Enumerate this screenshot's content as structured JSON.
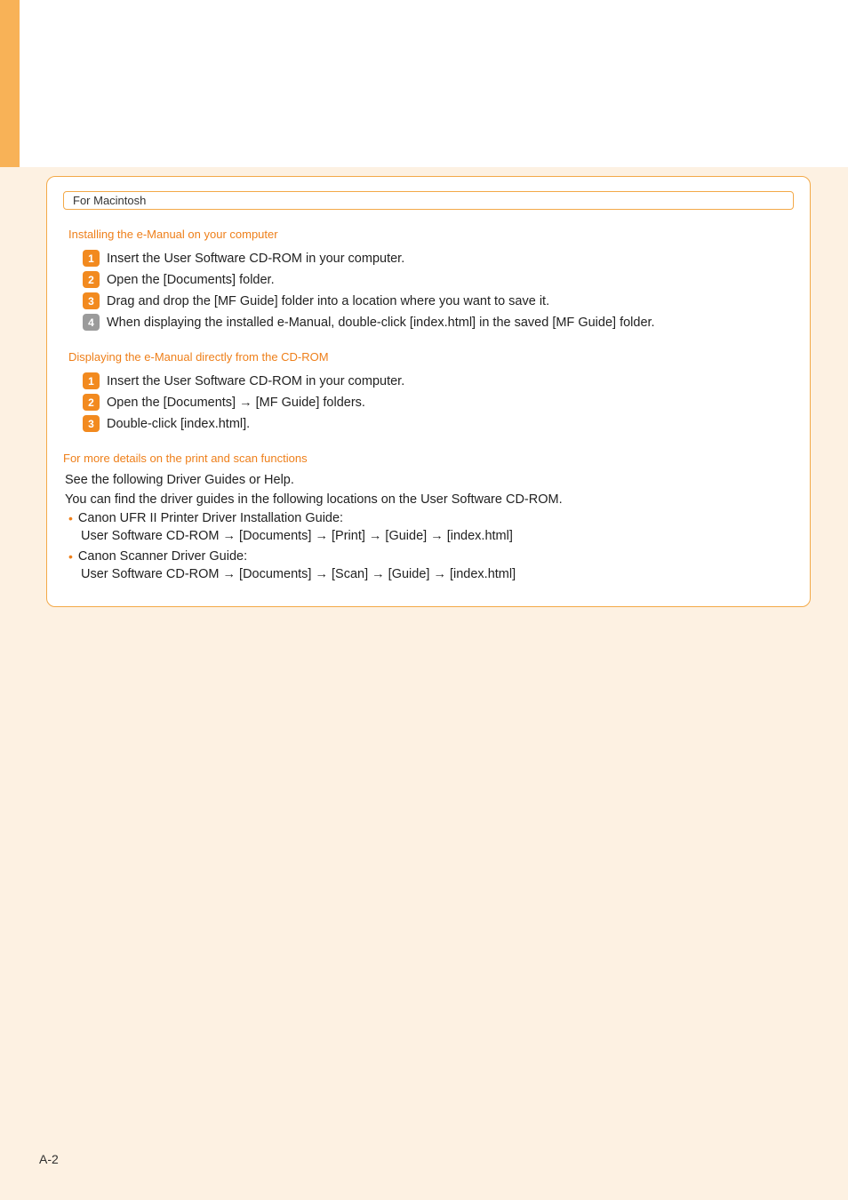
{
  "tag": "For Macintosh",
  "sectionInstall": {
    "title": "Installing the e-Manual on your computer",
    "steps": [
      "Insert the User Software CD-ROM in your computer.",
      "Open the [Documents] folder.",
      "Drag and drop the [MF Guide] folder into a location where you want to save it.",
      "When displaying the installed e-Manual, double-click [index.html] in the saved [MF Guide] folder."
    ]
  },
  "sectionDisplay": {
    "title": "Displaying the e-Manual directly from the CD-ROM",
    "steps": [
      "Insert the User Software CD-ROM in your computer.",
      "Open the [Documents] → [MF Guide] folders.",
      "Double-click [index.html]."
    ]
  },
  "sectionDetails": {
    "title": "For more details on the print and scan functions",
    "intro1": "See the following Driver Guides or Help.",
    "intro2": "You can find the driver guides in the following locations on the User Software CD-ROM.",
    "bullets": [
      {
        "head": "Canon UFR II Printer Driver Installation Guide:",
        "sub": "User Software CD-ROM → [Documents] → [Print] → [Guide] → [index.html]"
      },
      {
        "head": "Canon Scanner Driver Guide:",
        "sub": "User Software CD-ROM → [Documents] → [Scan] → [Guide] →  [index.html]"
      }
    ]
  },
  "pageNumber": "A-2"
}
